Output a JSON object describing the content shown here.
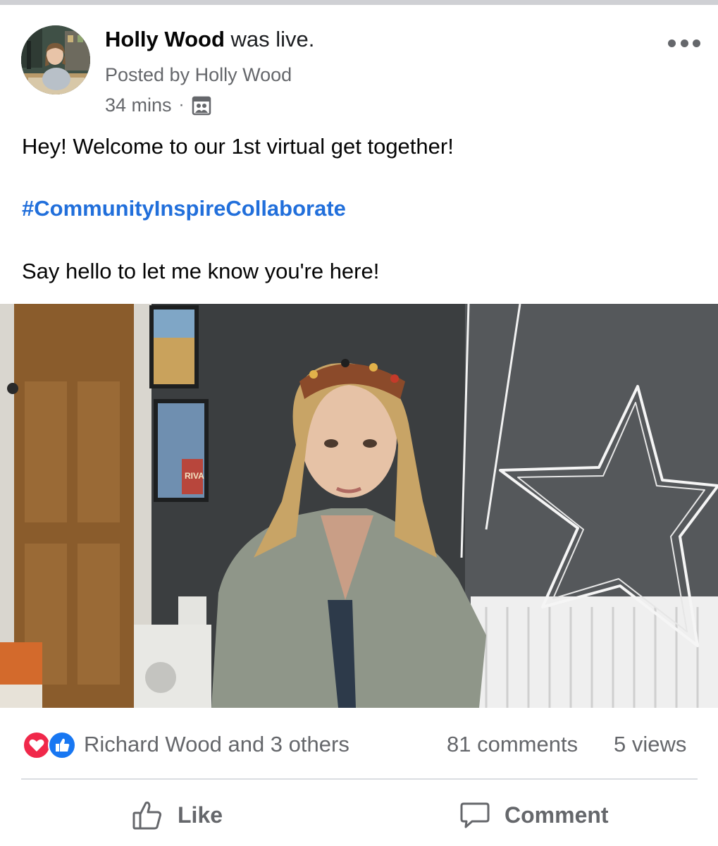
{
  "post": {
    "author_name": "Holly Wood",
    "author_suffix": "was live.",
    "posted_by": "Posted by Holly Wood",
    "time": "34 mins",
    "separator": "·",
    "audience_icon": "group-audience-icon",
    "more_icon": "more-options-icon",
    "text_line_1": "Hey! Welcome to our 1st virtual get together!",
    "hashtag": "#CommunityInspireCollaborate",
    "text_line_3": "Say hello to let me know you're here!"
  },
  "video": {
    "poster_text": "RIVA"
  },
  "reactions": {
    "icons": [
      "love-reaction-icon",
      "like-reaction-icon"
    ],
    "names": "Richard Wood and 3 others",
    "comments": "81 comments",
    "views": "5 views"
  },
  "actions": {
    "like_label": "Like",
    "like_icon": "thumbs-up-icon",
    "comment_label": "Comment",
    "comment_icon": "comment-bubble-icon"
  },
  "colors": {
    "hashtag": "#216fdb",
    "secondary_text": "#65676b",
    "love": "#f0284a",
    "like": "#1877f2"
  }
}
